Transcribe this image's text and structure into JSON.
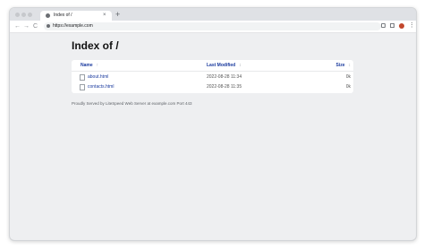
{
  "browser": {
    "tab_title": "Index of /",
    "tab_close": "×",
    "new_tab": "+",
    "url": "https://example.com",
    "back": "←",
    "forward": "→",
    "reload": "C",
    "menu": "⋮"
  },
  "page": {
    "title": "Index of /",
    "columns": {
      "name": "Name",
      "last_modified": "Last Modified",
      "size": "Size",
      "name_sort": "↑",
      "modified_sort": "↕",
      "size_sort": "↕"
    },
    "files": [
      {
        "name": "about.html",
        "modified": "2022-08-28 11:34",
        "size": "0k"
      },
      {
        "name": "contacts.html",
        "modified": "2022-08-28 11:35",
        "size": "0k"
      }
    ],
    "footer": "Proudly Served by LiteSpeed Web Server at example.com Port 443"
  }
}
